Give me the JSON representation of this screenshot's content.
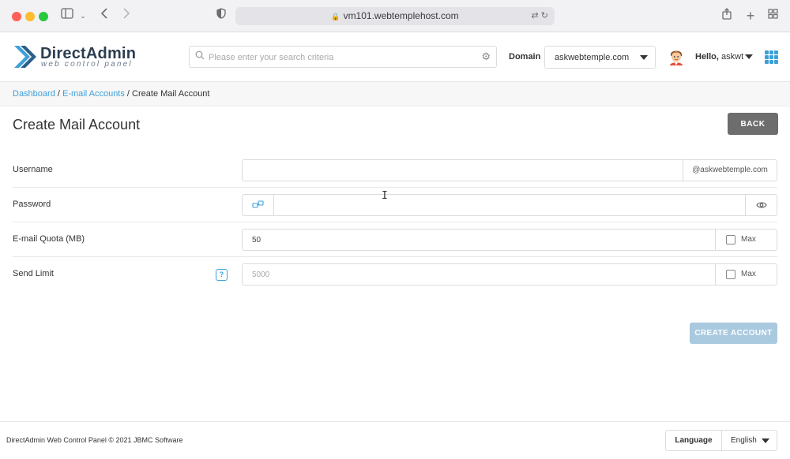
{
  "browser": {
    "url": "vm101.webtemplehost.com"
  },
  "header": {
    "logo_title": "DirectAdmin",
    "logo_subtitle": "web control panel",
    "search_placeholder": "Please enter your search criteria",
    "domain_label": "Domain",
    "domain_value": "askwebtemple.com",
    "hello_prefix": "Hello,",
    "username": "askwt"
  },
  "breadcrumb": {
    "items": [
      "Dashboard",
      "E-mail Accounts"
    ],
    "separator": " / ",
    "current": "Create Mail Account"
  },
  "page": {
    "title": "Create Mail Account",
    "back_label": "BACK"
  },
  "form": {
    "username": {
      "label": "Username",
      "value": "",
      "suffix": "@askwebtemple.com"
    },
    "password": {
      "label": "Password",
      "value": ""
    },
    "quota": {
      "label": "E-mail Quota (MB)",
      "value": "50",
      "max_label": "Max",
      "max_checked": false
    },
    "send_limit": {
      "label": "Send Limit",
      "help": "?",
      "placeholder": "5000",
      "max_label": "Max",
      "max_checked": false
    },
    "submit_label": "CREATE ACCOUNT"
  },
  "footer": {
    "copyright": "DirectAdmin Web Control Panel © 2021 JBMC Software",
    "language_label": "Language",
    "language_value": "English"
  },
  "colors": {
    "accent": "#3ca0d8",
    "back_button": "#6d6d6d",
    "create_button": "#a9c9df"
  }
}
